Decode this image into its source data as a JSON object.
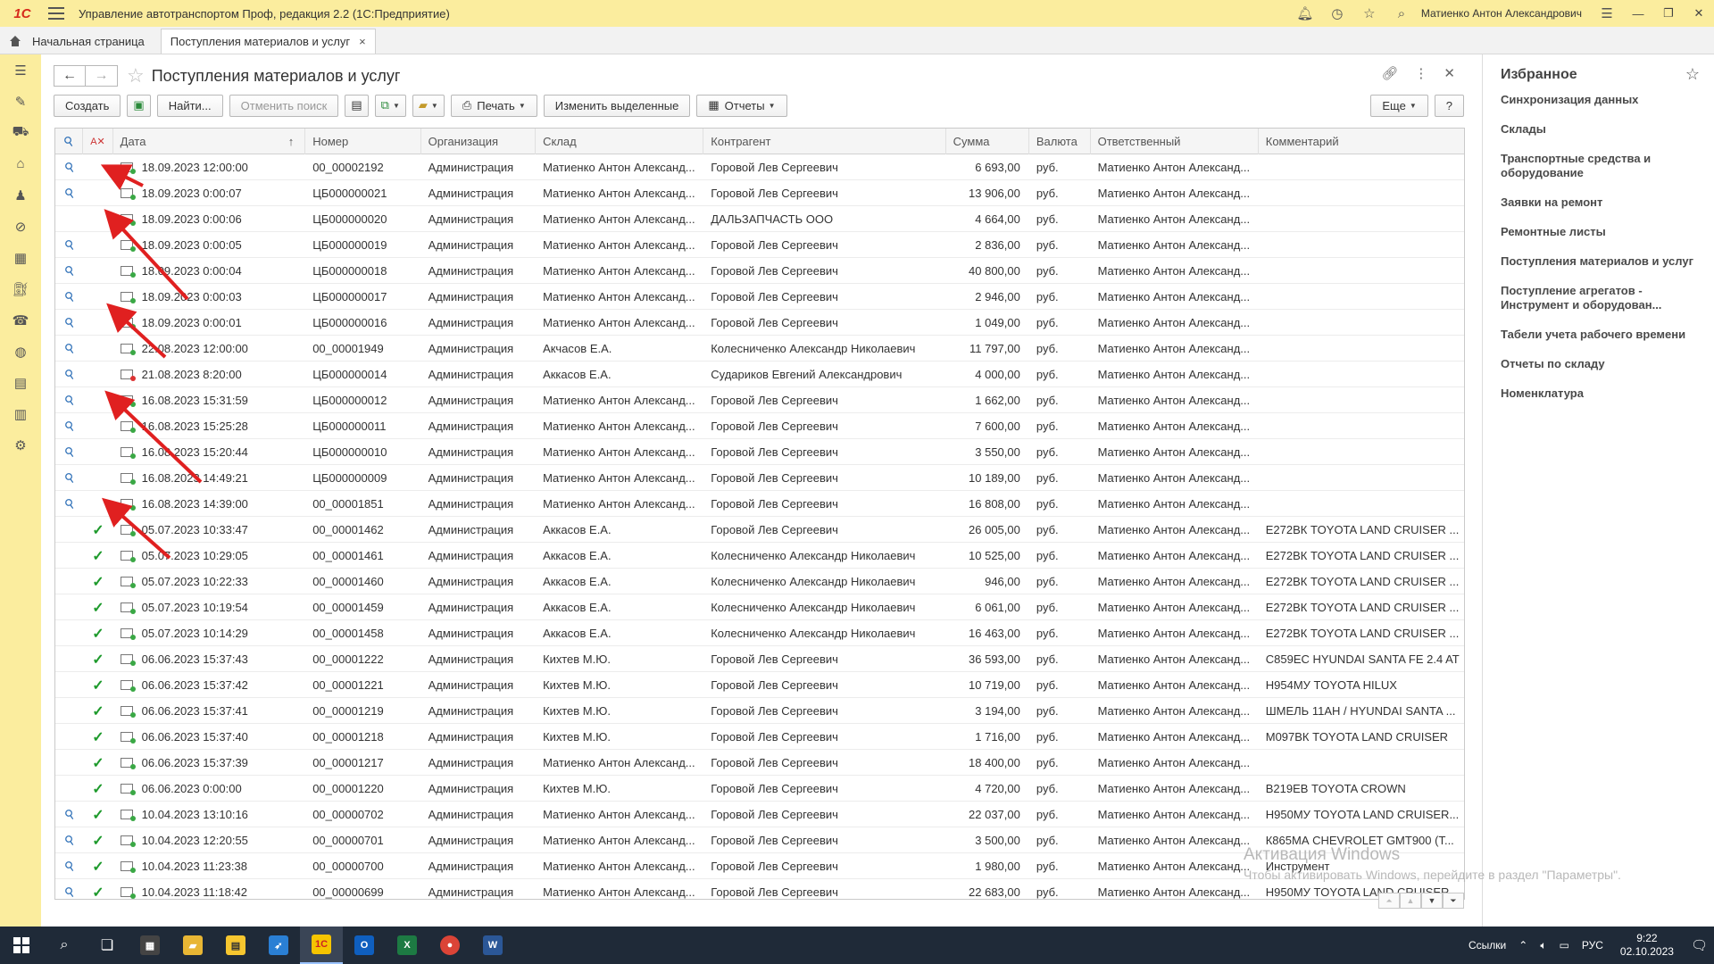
{
  "app": {
    "logo": "1С",
    "title": "Управление автотранспортом Проф, редакция 2.2  (1С:Предприятие)",
    "user": "Матиенко Антон Александрович"
  },
  "tabs": [
    {
      "label": "Начальная страница"
    },
    {
      "label": "Поступления материалов и услуг",
      "close": "×"
    }
  ],
  "page": {
    "title": "Поступления материалов и услуг"
  },
  "toolbar": {
    "create": "Создать",
    "find": "Найти...",
    "cancel_search": "Отменить поиск",
    "print": "Печать",
    "change_selected": "Изменить выделенные",
    "reports": "Отчеты",
    "more": "Еще",
    "help": "?"
  },
  "table": {
    "columns": [
      "Дата",
      "Номер",
      "Организация",
      "Склад",
      "Контрагент",
      "Сумма",
      "Валюта",
      "Ответственный",
      "Комментарий"
    ],
    "sort_indicator": "↑",
    "rows": [
      {
        "clip": true,
        "check": false,
        "doc": "green",
        "date": "18.09.2023 12:00:00",
        "num": "00_00002192",
        "org": "Администрация",
        "stock": "Матиенко Антон Александ...",
        "contr": "Горовой Лев Сергеевич",
        "sum": "6 693,00",
        "cur": "руб.",
        "resp": "Матиенко Антон Александ...",
        "comm": ""
      },
      {
        "clip": true,
        "check": false,
        "doc": "green",
        "date": "18.09.2023 0:00:07",
        "num": "ЦБ000000021",
        "org": "Администрация",
        "stock": "Матиенко Антон Александ...",
        "contr": "Горовой Лев Сергеевич",
        "sum": "13 906,00",
        "cur": "руб.",
        "resp": "Матиенко Антон Александ...",
        "comm": ""
      },
      {
        "clip": false,
        "check": false,
        "doc": "green",
        "date": "18.09.2023 0:00:06",
        "num": "ЦБ000000020",
        "org": "Администрация",
        "stock": "Матиенко Антон Александ...",
        "contr": "ДАЛЬЗАПЧАСТЬ ООО",
        "sum": "4 664,00",
        "cur": "руб.",
        "resp": "Матиенко Антон Александ...",
        "comm": ""
      },
      {
        "clip": true,
        "check": false,
        "doc": "green",
        "date": "18.09.2023 0:00:05",
        "num": "ЦБ000000019",
        "org": "Администрация",
        "stock": "Матиенко Антон Александ...",
        "contr": "Горовой Лев Сергеевич",
        "sum": "2 836,00",
        "cur": "руб.",
        "resp": "Матиенко Антон Александ...",
        "comm": ""
      },
      {
        "clip": true,
        "check": false,
        "doc": "green",
        "date": "18.09.2023 0:00:04",
        "num": "ЦБ000000018",
        "org": "Администрация",
        "stock": "Матиенко Антон Александ...",
        "contr": "Горовой Лев Сергеевич",
        "sum": "40 800,00",
        "cur": "руб.",
        "resp": "Матиенко Антон Александ...",
        "comm": ""
      },
      {
        "clip": true,
        "check": false,
        "doc": "green",
        "date": "18.09.2023 0:00:03",
        "num": "ЦБ000000017",
        "org": "Администрация",
        "stock": "Матиенко Антон Александ...",
        "contr": "Горовой Лев Сергеевич",
        "sum": "2 946,00",
        "cur": "руб.",
        "resp": "Матиенко Антон Александ...",
        "comm": ""
      },
      {
        "clip": true,
        "check": false,
        "doc": "green",
        "date": "18.09.2023 0:00:01",
        "num": "ЦБ000000016",
        "org": "Администрация",
        "stock": "Матиенко Антон Александ...",
        "contr": "Горовой Лев Сергеевич",
        "sum": "1 049,00",
        "cur": "руб.",
        "resp": "Матиенко Антон Александ...",
        "comm": ""
      },
      {
        "clip": true,
        "check": false,
        "doc": "green",
        "date": "22.08.2023 12:00:00",
        "num": "00_00001949",
        "org": "Администрация",
        "stock": "Акчасов Е.А.",
        "contr": "Колесниченко Александр Николаевич",
        "sum": "11 797,00",
        "cur": "руб.",
        "resp": "Матиенко Антон Александ...",
        "comm": ""
      },
      {
        "clip": true,
        "check": false,
        "doc": "red",
        "date": "21.08.2023 8:20:00",
        "num": "ЦБ000000014",
        "org": "Администрация",
        "stock": "Аккасов Е.А.",
        "contr": "Судариков Евгений Александрович",
        "sum": "4 000,00",
        "cur": "руб.",
        "resp": "Матиенко Антон Александ...",
        "comm": ""
      },
      {
        "clip": true,
        "check": false,
        "doc": "green",
        "date": "16.08.2023 15:31:59",
        "num": "ЦБ000000012",
        "org": "Администрация",
        "stock": "Матиенко Антон Александ...",
        "contr": "Горовой Лев Сергеевич",
        "sum": "1 662,00",
        "cur": "руб.",
        "resp": "Матиенко Антон Александ...",
        "comm": ""
      },
      {
        "clip": true,
        "check": false,
        "doc": "green",
        "date": "16.08.2023 15:25:28",
        "num": "ЦБ000000011",
        "org": "Администрация",
        "stock": "Матиенко Антон Александ...",
        "contr": "Горовой Лев Сергеевич",
        "sum": "7 600,00",
        "cur": "руб.",
        "resp": "Матиенко Антон Александ...",
        "comm": ""
      },
      {
        "clip": true,
        "check": false,
        "doc": "green",
        "date": "16.08.2023 15:20:44",
        "num": "ЦБ000000010",
        "org": "Администрация",
        "stock": "Матиенко Антон Александ...",
        "contr": "Горовой Лев Сергеевич",
        "sum": "3 550,00",
        "cur": "руб.",
        "resp": "Матиенко Антон Александ...",
        "comm": ""
      },
      {
        "clip": true,
        "check": false,
        "doc": "green",
        "date": "16.08.2023 14:49:21",
        "num": "ЦБ000000009",
        "org": "Администрация",
        "stock": "Матиенко Антон Александ...",
        "contr": "Горовой Лев Сергеевич",
        "sum": "10 189,00",
        "cur": "руб.",
        "resp": "Матиенко Антон Александ...",
        "comm": ""
      },
      {
        "clip": true,
        "check": false,
        "doc": "green",
        "date": "16.08.2023 14:39:00",
        "num": "00_00001851",
        "org": "Администрация",
        "stock": "Матиенко Антон Александ...",
        "contr": "Горовой Лев Сергеевич",
        "sum": "16 808,00",
        "cur": "руб.",
        "resp": "Матиенко Антон Александ...",
        "comm": ""
      },
      {
        "clip": false,
        "check": true,
        "doc": "green",
        "date": "05.07.2023 10:33:47",
        "num": "00_00001462",
        "org": "Администрация",
        "stock": "Аккасов Е.А.",
        "contr": "Горовой Лев Сергеевич",
        "sum": "26 005,00",
        "cur": "руб.",
        "resp": "Матиенко Антон Александ...",
        "comm": "Е272ВК TOYOTA LAND CRUISER ..."
      },
      {
        "clip": false,
        "check": true,
        "doc": "green",
        "date": "05.07.2023 10:29:05",
        "num": "00_00001461",
        "org": "Администрация",
        "stock": "Аккасов Е.А.",
        "contr": "Колесниченко Александр Николаевич",
        "sum": "10 525,00",
        "cur": "руб.",
        "resp": "Матиенко Антон Александ...",
        "comm": "Е272ВК TOYOTA LAND CRUISER ..."
      },
      {
        "clip": false,
        "check": true,
        "doc": "green",
        "date": "05.07.2023 10:22:33",
        "num": "00_00001460",
        "org": "Администрация",
        "stock": "Аккасов Е.А.",
        "contr": "Колесниченко Александр Николаевич",
        "sum": "946,00",
        "cur": "руб.",
        "resp": "Матиенко Антон Александ...",
        "comm": "Е272ВК TOYOTA LAND CRUISER ..."
      },
      {
        "clip": false,
        "check": true,
        "doc": "green",
        "date": "05.07.2023 10:19:54",
        "num": "00_00001459",
        "org": "Администрация",
        "stock": "Аккасов Е.А.",
        "contr": "Колесниченко Александр Николаевич",
        "sum": "6 061,00",
        "cur": "руб.",
        "resp": "Матиенко Антон Александ...",
        "comm": "Е272ВК TOYOTA LAND CRUISER ..."
      },
      {
        "clip": false,
        "check": true,
        "doc": "green",
        "date": "05.07.2023 10:14:29",
        "num": "00_00001458",
        "org": "Администрация",
        "stock": "Аккасов Е.А.",
        "contr": "Колесниченко Александр Николаевич",
        "sum": "16 463,00",
        "cur": "руб.",
        "resp": "Матиенко Антон Александ...",
        "comm": "Е272ВК TOYOTA LAND CRUISER ..."
      },
      {
        "clip": false,
        "check": true,
        "doc": "green",
        "date": "06.06.2023 15:37:43",
        "num": "00_00001222",
        "org": "Администрация",
        "stock": "Кихтев М.Ю.",
        "contr": "Горовой Лев Сергеевич",
        "sum": "36 593,00",
        "cur": "руб.",
        "resp": "Матиенко Антон Александ...",
        "comm": "С859ЕС HYUNDAI SANTA FE 2.4 AT"
      },
      {
        "clip": false,
        "check": true,
        "doc": "green",
        "date": "06.06.2023 15:37:42",
        "num": "00_00001221",
        "org": "Администрация",
        "stock": "Кихтев М.Ю.",
        "contr": "Горовой Лев Сергеевич",
        "sum": "10 719,00",
        "cur": "руб.",
        "resp": "Матиенко Антон Александ...",
        "comm": "Н954МУ TOYOTA HILUX"
      },
      {
        "clip": false,
        "check": true,
        "doc": "green",
        "date": "06.06.2023 15:37:41",
        "num": "00_00001219",
        "org": "Администрация",
        "stock": "Кихтев М.Ю.",
        "contr": "Горовой Лев Сергеевич",
        "sum": "3 194,00",
        "cur": "руб.",
        "resp": "Матиенко Антон Александ...",
        "comm": "ШМЕЛЬ 11АН / HYUNDAI SANTA ..."
      },
      {
        "clip": false,
        "check": true,
        "doc": "green",
        "date": "06.06.2023 15:37:40",
        "num": "00_00001218",
        "org": "Администрация",
        "stock": "Кихтев М.Ю.",
        "contr": "Горовой Лев Сергеевич",
        "sum": "1 716,00",
        "cur": "руб.",
        "resp": "Матиенко Антон Александ...",
        "comm": "М097ВК TOYOTA LAND CRUISER"
      },
      {
        "clip": false,
        "check": true,
        "doc": "green",
        "date": "06.06.2023 15:37:39",
        "num": "00_00001217",
        "org": "Администрация",
        "stock": "Матиенко Антон Александ...",
        "contr": "Горовой Лев Сергеевич",
        "sum": "18 400,00",
        "cur": "руб.",
        "resp": "Матиенко Антон Александ...",
        "comm": ""
      },
      {
        "clip": false,
        "check": true,
        "doc": "green",
        "date": "06.06.2023 0:00:00",
        "num": "00_00001220",
        "org": "Администрация",
        "stock": "Кихтев М.Ю.",
        "contr": "Горовой Лев Сергеевич",
        "sum": "4 720,00",
        "cur": "руб.",
        "resp": "Матиенко Антон Александ...",
        "comm": "В219ЕВ TOYOTA CROWN"
      },
      {
        "clip": true,
        "check": true,
        "doc": "green",
        "date": "10.04.2023 13:10:16",
        "num": "00_00000702",
        "org": "Администрация",
        "stock": "Матиенко Антон Александ...",
        "contr": "Горовой Лев Сергеевич",
        "sum": "22 037,00",
        "cur": "руб.",
        "resp": "Матиенко Антон Александ...",
        "comm": "Н950МУ TOYOTA LAND CRUISER..."
      },
      {
        "clip": true,
        "check": true,
        "doc": "green",
        "date": "10.04.2023 12:20:55",
        "num": "00_00000701",
        "org": "Администрация",
        "stock": "Матиенко Антон Александ...",
        "contr": "Горовой Лев Сергеевич",
        "sum": "3 500,00",
        "cur": "руб.",
        "resp": "Матиенко Антон Александ...",
        "comm": "К865МА CHEVROLET GMT900 (Т..."
      },
      {
        "clip": true,
        "check": true,
        "doc": "green",
        "date": "10.04.2023 11:23:38",
        "num": "00_00000700",
        "org": "Администрация",
        "stock": "Матиенко Антон Александ...",
        "contr": "Горовой Лев Сергеевич",
        "sum": "1 980,00",
        "cur": "руб.",
        "resp": "Матиенко Антон Александ...",
        "comm": "Инструмент"
      },
      {
        "clip": true,
        "check": true,
        "doc": "green",
        "date": "10.04.2023 11:18:42",
        "num": "00_00000699",
        "org": "Администрация",
        "stock": "Матиенко Антон Александ...",
        "contr": "Горовой Лев Сергеевич",
        "sum": "22 683,00",
        "cur": "руб.",
        "resp": "Матиенко Антон Александ...",
        "comm": "Н950МУ TOYOTA LAND CRUISER..."
      }
    ]
  },
  "favorites": {
    "title": "Избранное",
    "items": [
      "Синхронизация данных",
      "Склады",
      "Транспортные средства и оборудование",
      "Заявки на ремонт",
      "Ремонтные листы",
      "Поступления материалов и услуг",
      "Поступление агрегатов - Инструмент и оборудован...",
      "Табели учета рабочего времени",
      "Отчеты по складу",
      "Номенклатура"
    ]
  },
  "watermark": {
    "line1": "Активация Windows",
    "line2": "Чтобы активировать Windows, перейдите в раздел \"Параметры\"."
  },
  "taskbar": {
    "links_label": "Ссылки",
    "lang": "РУС",
    "time": "9:22",
    "date": "02.10.2023"
  },
  "colors": {
    "panel_yellow": "#fbed9e",
    "check_green": "#1e9a2c",
    "clip_blue": "#2d6fb7",
    "arrow_red": "#e02020"
  }
}
